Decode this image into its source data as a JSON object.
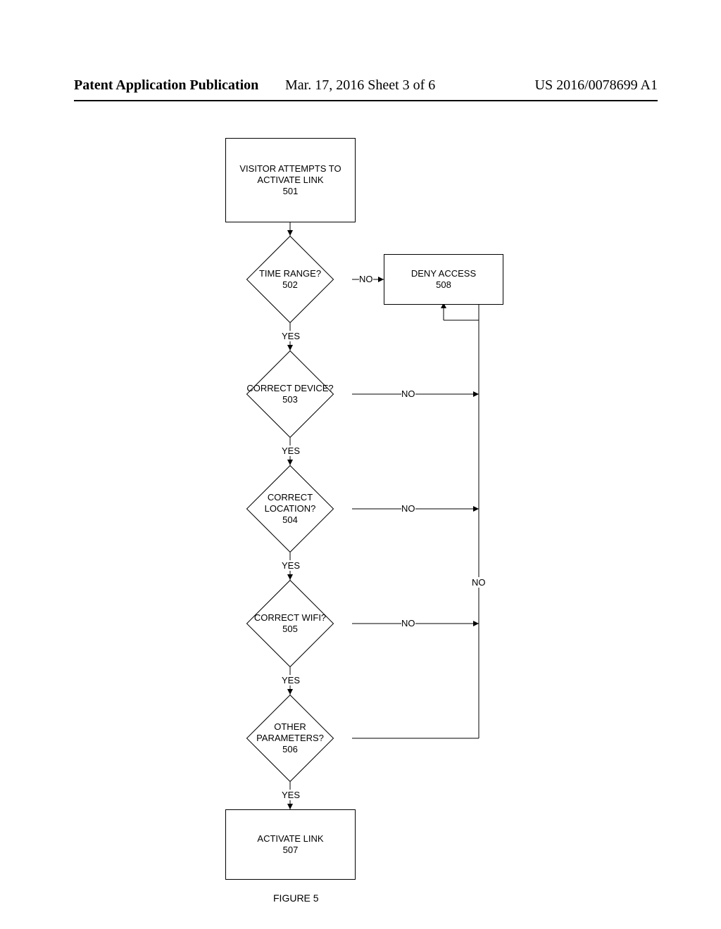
{
  "header": {
    "left": "Patent Application Publication",
    "middle": "Mar. 17, 2016  Sheet 3 of 6",
    "right": "US 2016/0078699 A1"
  },
  "start_box": {
    "line1": "VISITOR ATTEMPTS TO",
    "line2": "ACTIVATE LINK",
    "num": "501"
  },
  "deny_box": {
    "line1": "DENY ACCESS",
    "num": "508"
  },
  "activate_box": {
    "line1": "ACTIVATE LINK",
    "num": "507"
  },
  "diamonds": {
    "d502": {
      "line1": "TIME RANGE?",
      "num": "502"
    },
    "d503": {
      "line1": "CORRECT DEVICE?",
      "num": "503"
    },
    "d504": {
      "line1": "CORRECT",
      "line2": "LOCATION?",
      "num": "504"
    },
    "d505": {
      "line1": "CORRECT WIFI?",
      "num": "505"
    },
    "d506": {
      "line1": "OTHER",
      "line2": "PARAMETERS?",
      "num": "506"
    }
  },
  "labels": {
    "yes": "YES",
    "no": "NO"
  },
  "figure_caption": "FIGURE 5"
}
